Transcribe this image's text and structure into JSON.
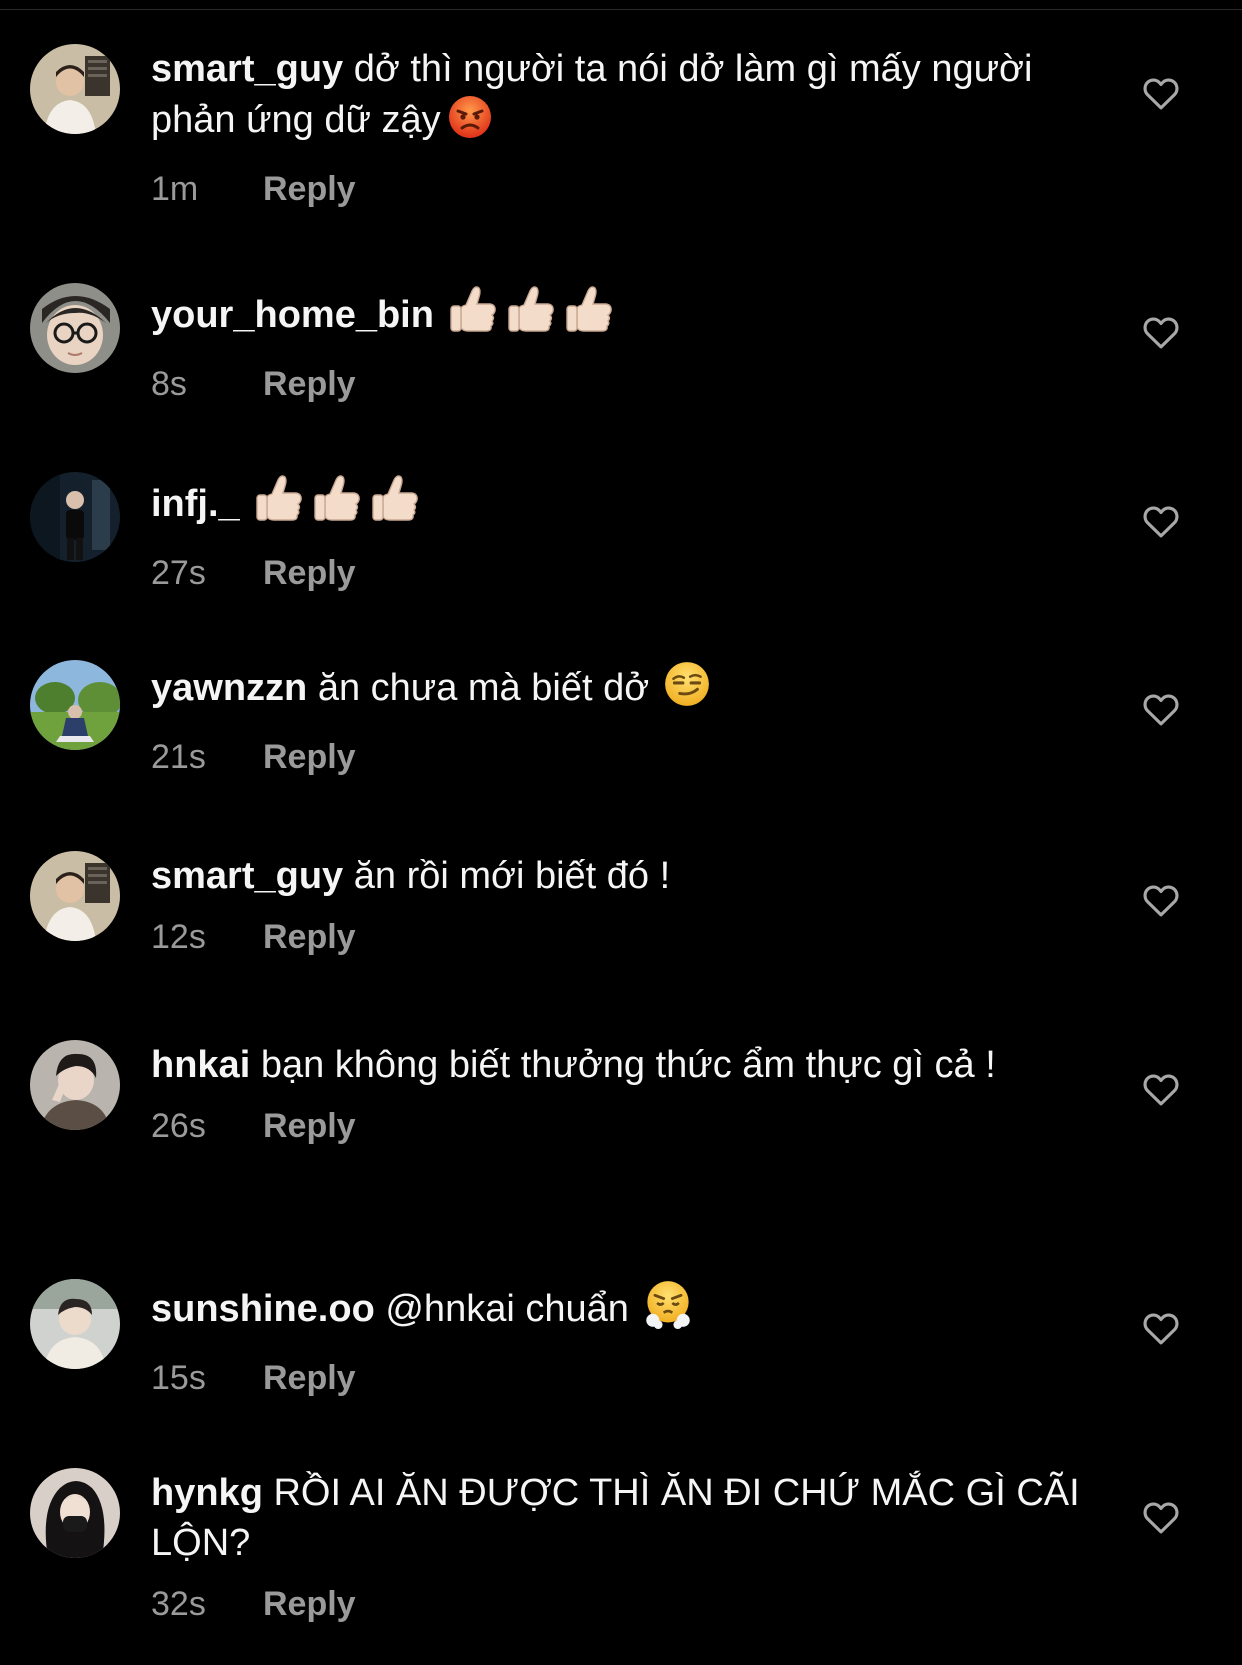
{
  "comments": [
    {
      "username": "smart_guy",
      "text": "dở thì người ta nói dở làm gì mấy người phản ứng dữ zậy",
      "emoji": "angry-face",
      "time": "1m",
      "reply_label": "Reply"
    },
    {
      "username": "your_home_bin",
      "text": "",
      "emoji": "thumbs-up-x3",
      "time": "8s",
      "reply_label": "Reply"
    },
    {
      "username": "infj._",
      "text": "",
      "emoji": "thumbs-up-x3",
      "time": "27s",
      "reply_label": "Reply"
    },
    {
      "username": "yawnzzn",
      "text": "ăn chưa mà biết dở",
      "emoji": "smirking-face",
      "time": "21s",
      "reply_label": "Reply"
    },
    {
      "username": "smart_guy",
      "text": "ăn rồi mới biết đó !",
      "emoji": "",
      "time": "12s",
      "reply_label": "Reply"
    },
    {
      "username": "hnkai",
      "text": "bạn không biết thưởng thức ẩm thực gì cả !",
      "emoji": "",
      "time": "26s",
      "reply_label": "Reply"
    },
    {
      "username": "sunshine.oo",
      "text": "@hnkai chuẩn",
      "emoji": "face-with-steam",
      "time": "15s",
      "reply_label": "Reply"
    },
    {
      "username": "hynkg",
      "text": "RỒI AI ĂN ĐƯỢC THÌ ĂN ĐI CHỨ MẮC GÌ CÃI LỘN?",
      "emoji": "",
      "time": "32s",
      "reply_label": "Reply"
    }
  ],
  "colors": {
    "background": "#000000",
    "text": "#f5f5f5",
    "secondary": "#9a9a9a"
  },
  "icons": {
    "like": "heart-outline-icon"
  }
}
